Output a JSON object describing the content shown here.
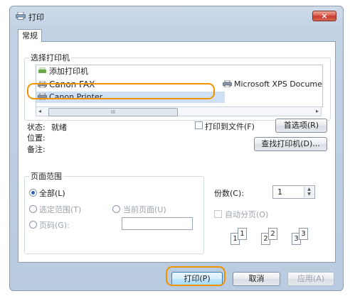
{
  "window": {
    "title": "打印",
    "close_label": "×"
  },
  "tabs": [
    {
      "label": "常规"
    }
  ],
  "select_printer": {
    "legend": "选择打印机",
    "printers": [
      {
        "label": "添加打印机",
        "icon": "add-printer-icon"
      },
      {
        "label": "Canon FAX",
        "icon": "printer-icon"
      },
      {
        "label": "Canon Printer",
        "icon": "printer-icon"
      },
      {
        "label": "Microsoft XPS Docume",
        "icon": "printer-icon"
      }
    ],
    "selected": "Canon FAX",
    "scroll_thumb_label": "III"
  },
  "status": {
    "status_label": "状态:",
    "status_value": "就绪",
    "location_label": "位置:",
    "comment_label": "备注:",
    "print_to_file_label": "打印到文件(F)",
    "preferences_button": "首选项(R)",
    "find_printer_button": "查找打印机(D)..."
  },
  "page_range": {
    "legend": "页面范围",
    "all_label": "全部(L)",
    "selection_label": "选定范围(T)",
    "current_page_label": "当前页面(U)",
    "pages_label": "页码(G):",
    "pages_value": "",
    "selected": "all"
  },
  "copies": {
    "count_label": "份数(C):",
    "count_value": "1",
    "collate_label": "自动分页(O)",
    "collate_checked": false,
    "collate_icons": [
      "1",
      "1",
      "2",
      "2",
      "3",
      "3"
    ]
  },
  "footer": {
    "print_button": "打印(P)",
    "cancel_button": "取消",
    "apply_button": "应用(A)"
  },
  "highlight_color": "#ef9300"
}
